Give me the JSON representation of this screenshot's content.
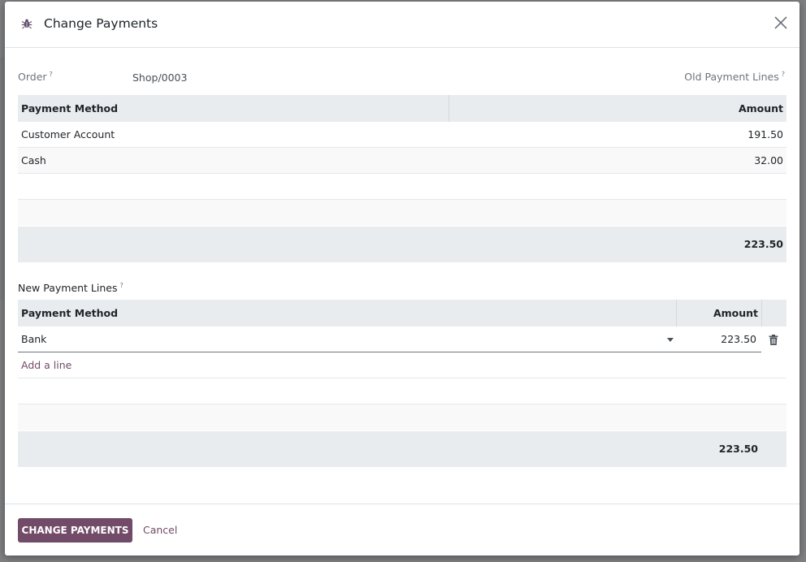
{
  "dialog": {
    "title": "Change Payments",
    "debug_icon": "bug-icon",
    "close_icon": "close-icon"
  },
  "order": {
    "label": "Order",
    "help": "?",
    "value": "Shop/0003"
  },
  "old_lines": {
    "label": "Old Payment Lines",
    "help": "?",
    "columns": {
      "method": "Payment Method",
      "amount": "Amount"
    },
    "rows": [
      {
        "method": "Customer Account",
        "amount": "191.50"
      },
      {
        "method": "Cash",
        "amount": "32.00"
      }
    ],
    "total": "223.50"
  },
  "new_lines": {
    "label": "New Payment Lines",
    "help": "?",
    "columns": {
      "method": "Payment Method",
      "amount": "Amount"
    },
    "rows": [
      {
        "method": "Bank",
        "amount": "223.50"
      }
    ],
    "add_line": "Add a line",
    "total": "223.50",
    "delete_icon": "trash-icon"
  },
  "footer": {
    "primary_label": "Change Payments",
    "cancel_label": "Cancel"
  },
  "colors": {
    "accent": "#714b67",
    "header_bg": "#e9ecef"
  }
}
